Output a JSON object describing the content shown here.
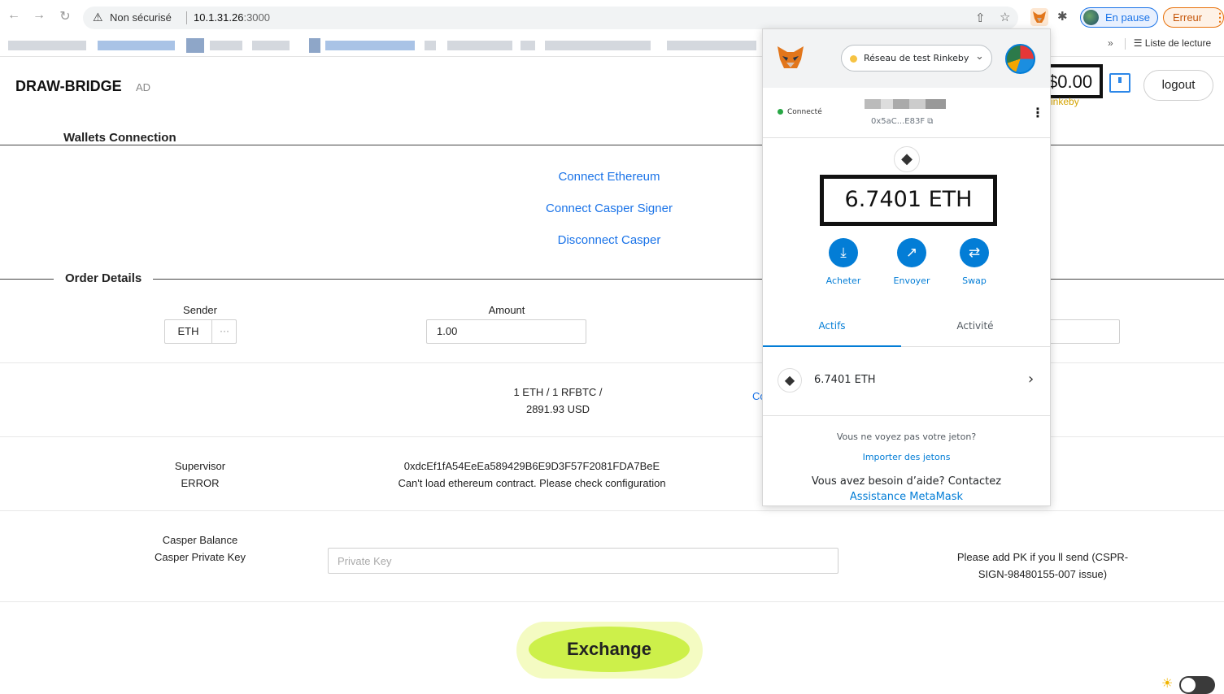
{
  "browser": {
    "security_label": "Non sécurisé",
    "url_host": "10.1.31.26",
    "url_port": ":3000",
    "pause_label": "En pause",
    "error_label": "Erreur",
    "reading_list_label": "Liste de lecture"
  },
  "header": {
    "brand": "DRAW-BRIDGE",
    "badge": "AD",
    "balance": "$0.00",
    "network_hint": "inkeby",
    "logout_label": "logout"
  },
  "wallets_section": {
    "title": "Wallets Connection",
    "links": [
      "Connect Ethereum",
      "Connect Casper Signer",
      "Disconnect Casper"
    ]
  },
  "order_section": {
    "title": "Order Details",
    "sender_label": "Sender",
    "sender_value": "ETH",
    "sender_more": "···",
    "amount_label": "Amount",
    "amount_value": "1.00",
    "rate_line1": "1 ETH / 1 RFBTC /",
    "rate_line2": "2891.93 USD",
    "rate_side_fragment": "Co",
    "supervisor_label": "Supervisor",
    "supervisor_status": "ERROR",
    "supervisor_address": "0xdcEf1fA54EeEa589429B6E9D3F57F2081FDA7BeE",
    "supervisor_error": "Can't load ethereum contract. Please check configuration",
    "casper_balance_label": "Casper Balance",
    "casper_pk_label": "Casper Private Key",
    "pk_placeholder": "Private Key",
    "pk_note_line1": "Please add PK if you ll send (CSPR-",
    "pk_note_line2": "SIGN-98480155-007 issue)",
    "exchange_label": "Exchange"
  },
  "metamask": {
    "network": "Réseau de test Rinkeby",
    "connected_label": "Connecté",
    "account_address": "0x5aC...E83F",
    "balance": "6.7401 ETH",
    "actions": [
      "Acheter",
      "Envoyer",
      "Swap"
    ],
    "tabs": [
      "Actifs",
      "Activité"
    ],
    "asset_name": "6.7401 ETH",
    "no_token_text": "Vous ne voyez pas votre jeton?",
    "import_link": "Importer des jetons",
    "help_text": "Vous avez besoin d’aide? Contactez",
    "support_link": "Assistance MetaMask"
  },
  "colors": {
    "link_blue": "#1a73e8",
    "metamask_blue": "#037dd6",
    "exchange_green": "#cdf04a",
    "network_dot": "#f6c343"
  },
  "icons": [
    "back-arrow-icon",
    "forward-arrow-icon",
    "reload-icon",
    "warning-icon",
    "share-icon",
    "bookmark-star-icon",
    "metamask-fox-icon",
    "extensions-icon",
    "wallet-icon",
    "ethereum-icon",
    "buy-icon",
    "send-icon",
    "swap-icon",
    "chevron-right-icon",
    "sun-icon"
  ]
}
